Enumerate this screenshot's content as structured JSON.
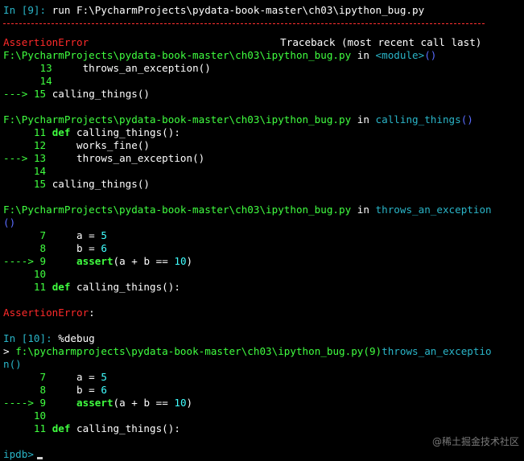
{
  "session": {
    "in9_prompt": "In [9]:",
    "in9_command": "run F:\\PycharmProjects\\pydata-book-master\\ch03\\ipython_bug.py",
    "error_name": "AssertionError",
    "traceback_header": "Traceback (most recent call last)",
    "frame1_file": "F:\\PycharmProjects\\pydata-book-master\\ch03\\ipython_bug.py",
    "in_word": "in",
    "frame1_func": "<module>",
    "frame1_paren": "()",
    "frame1_lines": [
      {
        "arrow": "",
        "no": "13",
        "code": "throws_an_exception()"
      },
      {
        "arrow": "",
        "no": "14",
        "code": ""
      },
      {
        "arrow": "--->",
        "no": "15",
        "code": "calling_things()"
      }
    ],
    "frame2_file": "F:\\PycharmProjects\\pydata-book-master\\ch03\\ipython_bug.py",
    "frame2_func": "calling_things",
    "frame2_paren": "()",
    "frame2_lines": [
      {
        "arrow": "",
        "no": "11",
        "kw": "def",
        "code": "calling_things():"
      },
      {
        "arrow": "",
        "no": "12",
        "code": "works_fine()"
      },
      {
        "arrow": "--->",
        "no": "13",
        "code": "throws_an_exception()"
      },
      {
        "arrow": "",
        "no": "14",
        "code": ""
      },
      {
        "arrow": "",
        "no": "15",
        "code": "calling_things()"
      }
    ],
    "frame3_file": "F:\\PycharmProjects\\pydata-book-master\\ch03\\ipython_bug.py",
    "frame3_func": "throws_an_exception",
    "frame3_paren_wrap": "()",
    "frame3_lines": {
      "l7_no": "7",
      "l7_code": "a = ",
      "l7_val": "5",
      "l8_no": "8",
      "l8_code": "b = ",
      "l8_val": "6",
      "l9_arrow": "---->",
      "l9_no": "9",
      "l9_kw": "assert",
      "l9_code": "(a + b == ",
      "l9_val": "10",
      "l9_close": ")",
      "l10_no": "10",
      "l11_no": "11",
      "l11_kw": "def",
      "l11_code": "calling_things():"
    },
    "final_error": "AssertionError",
    "final_colon": ":",
    "in10_prompt": "In [10]:",
    "in10_command": "%debug",
    "debug_pointer": ">",
    "debug_location": "f:\\pycharmprojects\\pydata-book-master\\ch03\\ipython_bug.py(9)",
    "debug_func": "throws_an_exceptio",
    "debug_func_wrap": "n()",
    "debug_lines": {
      "l7_no": "7",
      "l7_code": "a = ",
      "l7_val": "5",
      "l8_no": "8",
      "l8_code": "b = ",
      "l8_val": "6",
      "l9_arrow": "---->",
      "l9_no": "9",
      "l9_kw": "assert",
      "l9_code": "(a + b == ",
      "l9_val": "10",
      "l9_close": ")",
      "l10_no": "10",
      "l11_no": "11",
      "l11_kw": "def",
      "l11_code": "calling_things():"
    },
    "ipdb_prompt": "ipdb>"
  },
  "watermark": "@稀土掘金技术社区",
  "colors": {
    "background": "#000000",
    "error_red": "#ff2a2a",
    "path_green": "#40ff40",
    "func_teal": "#2ab5c8",
    "module_blue": "#5a6cff",
    "number_cyan": "#40ffff"
  }
}
